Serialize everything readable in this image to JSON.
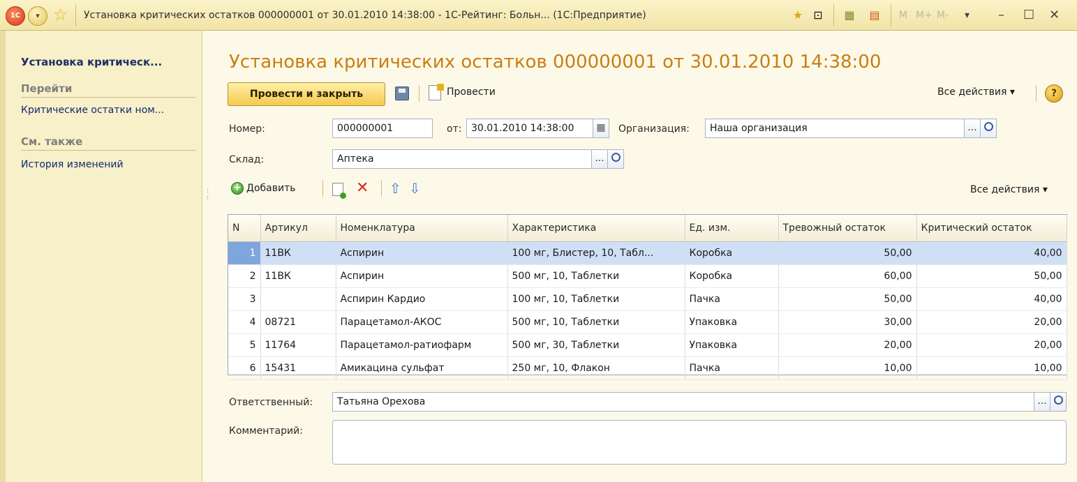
{
  "window": {
    "title": "Установка критических остатков 000000001 от 30.01.2010 14:38:00 - 1С-Рейтинг: Больн... (1С:Предприятие)",
    "logo_text": "1С",
    "memory_m": "M",
    "memory_mplus": "M+",
    "memory_mminus": "M-"
  },
  "sidebar": {
    "title": "Установка критическ...",
    "goto_header": "Перейти",
    "goto_items": [
      {
        "label": "Критические остатки ном..."
      }
    ],
    "see_also_header": "См. также",
    "see_also_items": [
      {
        "label": "История изменений"
      }
    ]
  },
  "document": {
    "title": "Установка критических остатков 000000001 от 30.01.2010 14:38:00"
  },
  "toolbar": {
    "post_close_label": "Провести и закрыть",
    "post_label": "Провести",
    "all_actions_label": "Все действия ▾",
    "help_glyph": "?"
  },
  "form": {
    "number_label": "Номер:",
    "number_value": "000000001",
    "from_label": "от:",
    "date_value": "30.01.2010 14:38:00",
    "organization_label": "Организация:",
    "organization_value": "Наша организация",
    "warehouse_label": "Склад:",
    "warehouse_value": "Аптека",
    "responsible_label": "Ответственный:",
    "responsible_value": "Татьяна Орехова",
    "comment_label": "Комментарий:",
    "comment_value": "",
    "select_glyph": "..."
  },
  "table_toolbar": {
    "add_label": "Добавить",
    "all_actions_label": "Все действия ▾"
  },
  "table": {
    "columns": [
      "N",
      "Артикул",
      "Номенклатура",
      "Характеристика",
      "Ед. изм.",
      "Тревожный остаток",
      "Критический остаток"
    ],
    "rows": [
      {
        "n": "1",
        "article": "11ВК",
        "item": "Аспирин",
        "characteristic": "100 мг, Блистер, 10, Табл...",
        "unit": "Коробка",
        "alarm": "50,00",
        "critical": "40,00",
        "selected": true
      },
      {
        "n": "2",
        "article": "11ВК",
        "item": "Аспирин",
        "characteristic": "500 мг, 10, Таблетки",
        "unit": "Коробка",
        "alarm": "60,00",
        "critical": "50,00"
      },
      {
        "n": "3",
        "article": "",
        "item": "Аспирин Кардио",
        "characteristic": "100 мг, 10, Таблетки",
        "unit": "Пачка",
        "alarm": "50,00",
        "critical": "40,00"
      },
      {
        "n": "4",
        "article": "08721",
        "item": "Парацетамол-АКОС",
        "characteristic": "500 мг, 10, Таблетки",
        "unit": "Упаковка",
        "alarm": "30,00",
        "critical": "20,00"
      },
      {
        "n": "5",
        "article": "11764",
        "item": "Парацетамол-ратиофарм",
        "characteristic": "500 мг, 30, Таблетки",
        "unit": "Упаковка",
        "alarm": "20,00",
        "critical": "20,00"
      },
      {
        "n": "6",
        "article": "15431",
        "item": "Амикацина сульфат",
        "characteristic": "250 мг, 10, Флакон",
        "unit": "Пачка",
        "alarm": "10,00",
        "critical": "10,00"
      }
    ]
  },
  "colors": {
    "accent_title": "#c97e12",
    "selection": "#cfe0f6",
    "sidebar_link": "#0f2a74"
  }
}
